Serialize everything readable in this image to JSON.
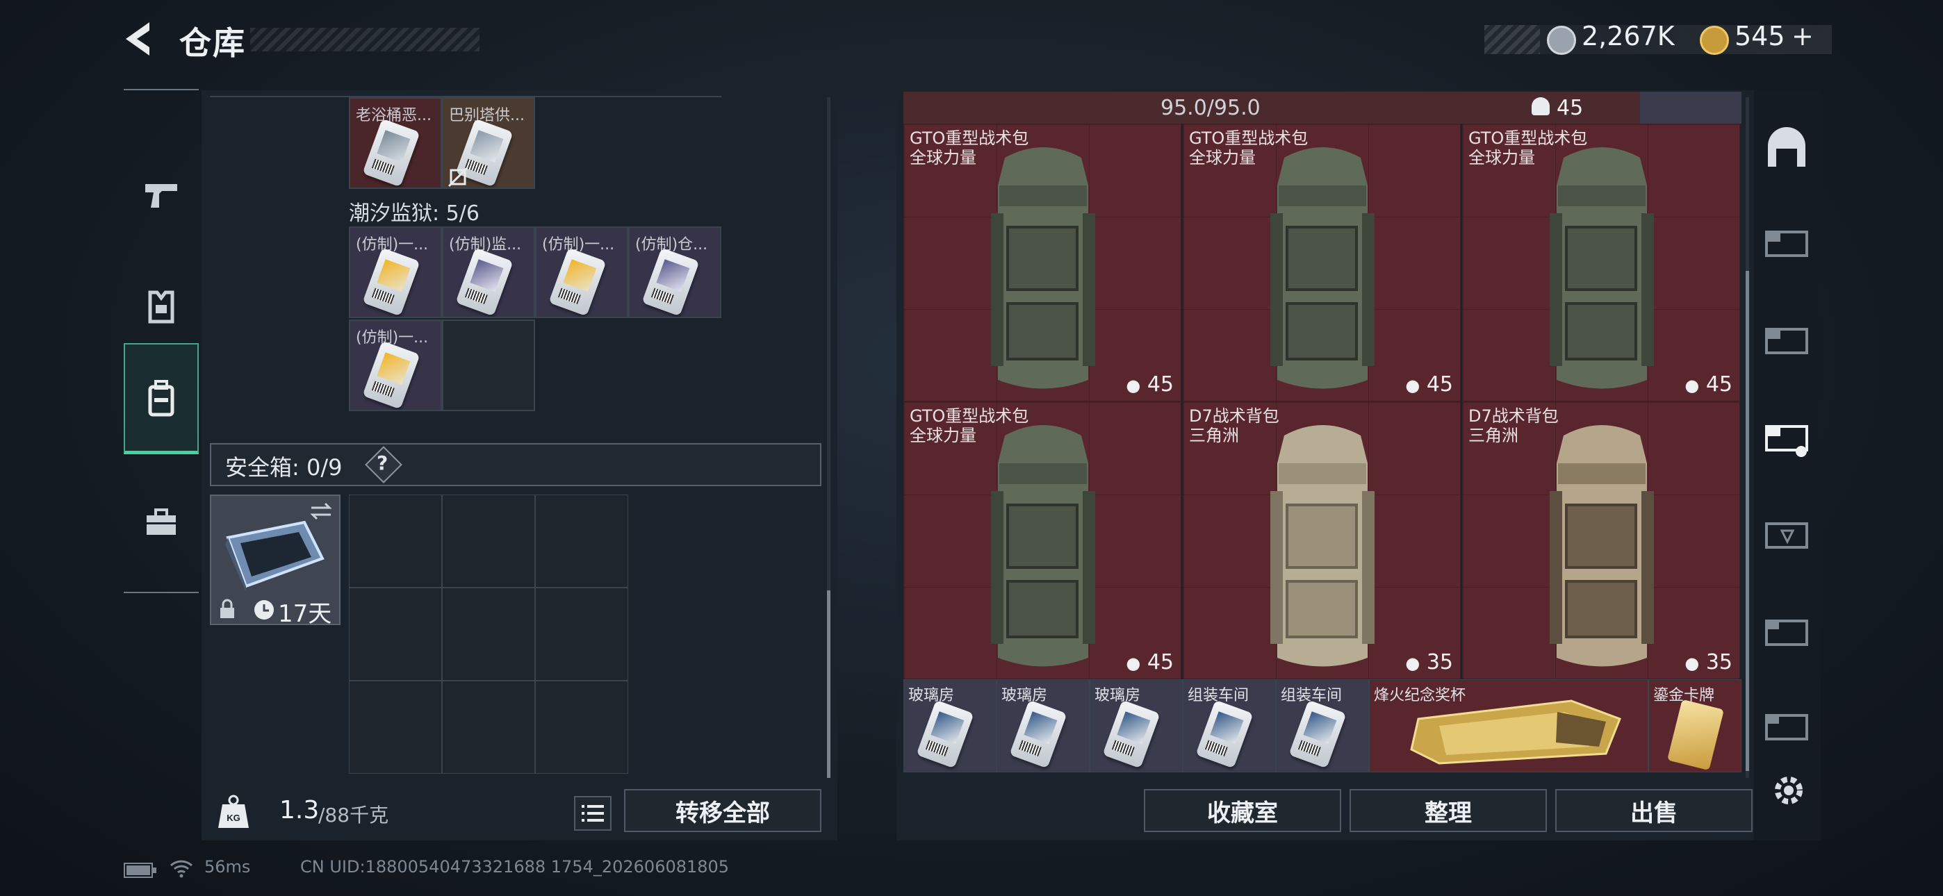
{
  "header": {
    "title": "仓库",
    "currency_1": "2,267K",
    "currency_2": "545",
    "currency_2_plus": "+"
  },
  "left_nav": {
    "items": [
      {
        "name": "weapons",
        "icon": "pistol-icon"
      },
      {
        "name": "armor",
        "icon": "vest-icon"
      },
      {
        "name": "backpack",
        "icon": "backpack-icon",
        "active": true
      },
      {
        "name": "container",
        "icon": "toolbox-icon"
      }
    ]
  },
  "left_panel": {
    "top_cards": [
      {
        "label": "老浴桶恶...",
        "bg": "red"
      },
      {
        "label": "巴别塔供...",
        "bg": "brown",
        "badge": "no-use-icon"
      }
    ],
    "prison_label": "潮汐监狱: 5/6",
    "prison_cards": [
      {
        "label": "(仿制)一..."
      },
      {
        "label": "(仿制)监..."
      },
      {
        "label": "(仿制)一..."
      },
      {
        "label": "(仿制)仓..."
      },
      {
        "label": "(仿制)一..."
      }
    ],
    "safe_box_label": "安全箱: 0/9",
    "help": "?",
    "safe_case_timer": "17天",
    "weight": "1.3",
    "weight_max": "/88千克",
    "transfer_all": "转移全部"
  },
  "right_panel": {
    "top_row_durability": "95.0/95.0",
    "top_row_weight": "45",
    "bags": [
      {
        "name": "GTO重型战术包",
        "sub": "全球力量",
        "weight": "45",
        "tone": "green"
      },
      {
        "name": "GTO重型战术包",
        "sub": "全球力量",
        "weight": "45",
        "tone": "green"
      },
      {
        "name": "GTO重型战术包",
        "sub": "全球力量",
        "weight": "45",
        "tone": "green"
      },
      {
        "name": "GTO重型战术包",
        "sub": "全球力量",
        "weight": "45",
        "tone": "green"
      },
      {
        "name": "D7战术背包",
        "sub": "三角洲",
        "weight": "35",
        "tone": "tan"
      },
      {
        "name": "D7战术背包",
        "sub": "三角洲",
        "weight": "35",
        "tone": "brown"
      }
    ],
    "small_items": [
      {
        "label": "玻璃房"
      },
      {
        "label": "玻璃房"
      },
      {
        "label": "玻璃房"
      },
      {
        "label": "组装车间"
      },
      {
        "label": "组装车间"
      }
    ],
    "trophy_label": "烽火纪念奖杯",
    "gold_card_label": "鎏金卡牌",
    "buttons": {
      "collection": "收藏室",
      "sort": "整理",
      "sell": "出售"
    }
  },
  "footer": {
    "ping": "56ms",
    "uid": "CN UID:18800540473321688 1754_202606081805"
  }
}
